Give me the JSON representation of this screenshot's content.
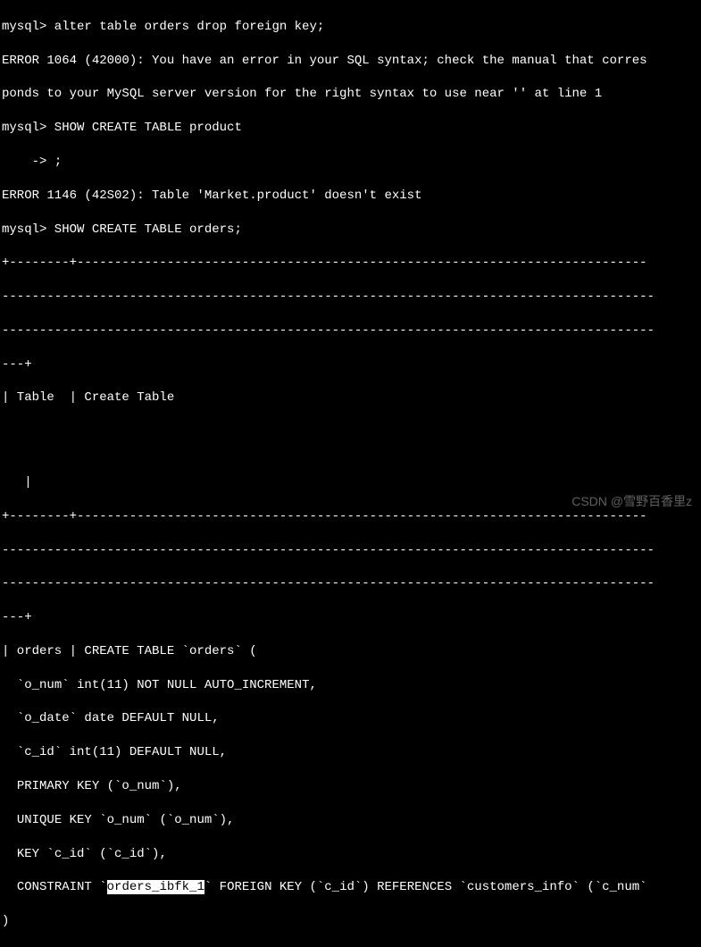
{
  "terminal": {
    "line1": "mysql> alter table orders drop foreign key;",
    "line2": "ERROR 1064 (42000): You have an error in your SQL syntax; check the manual that corres",
    "line3": "ponds to your MySQL server version for the right syntax to use near '' at line 1",
    "line4": "mysql> SHOW CREATE TABLE product",
    "line5": "    -> ;",
    "line6": "ERROR 1146 (42S02): Table 'Market.product' doesn't exist",
    "line7": "mysql> SHOW CREATE TABLE orders;",
    "sep1": "+--------+----------------------------------------------------------------------------",
    "sep2": "---------------------------------------------------------------------------------------",
    "sep3": "---------------------------------------------------------------------------------------",
    "sep4": "---+",
    "header1": "| Table  | Create Table",
    "blank": "",
    "header2": "   |",
    "sep5": "+--------+----------------------------------------------------------------------------",
    "sep6": "---------------------------------------------------------------------------------------",
    "sep7": "---------------------------------------------------------------------------------------",
    "sep8": "---+",
    "create1": "| orders | CREATE TABLE `orders` (",
    "create2": "  `o_num` int(11) NOT NULL AUTO_INCREMENT,",
    "create3": "  `o_date` date DEFAULT NULL,",
    "create4": "  `c_id` int(11) DEFAULT NULL,",
    "create5": "  PRIMARY KEY (`o_num`),",
    "create6": "  UNIQUE KEY `o_num` (`o_num`),",
    "create7": "  KEY `c_id` (`c_id`),",
    "constraint_prefix": "  CONSTRAINT `",
    "constraint_highlight": "orders_ibfk_1",
    "constraint_suffix": "` FOREIGN KEY (`c_id`) REFERENCES `customers_info` (`c_num`",
    "create9": ")"
  },
  "watermark": "CSDN @雪野百香里z"
}
